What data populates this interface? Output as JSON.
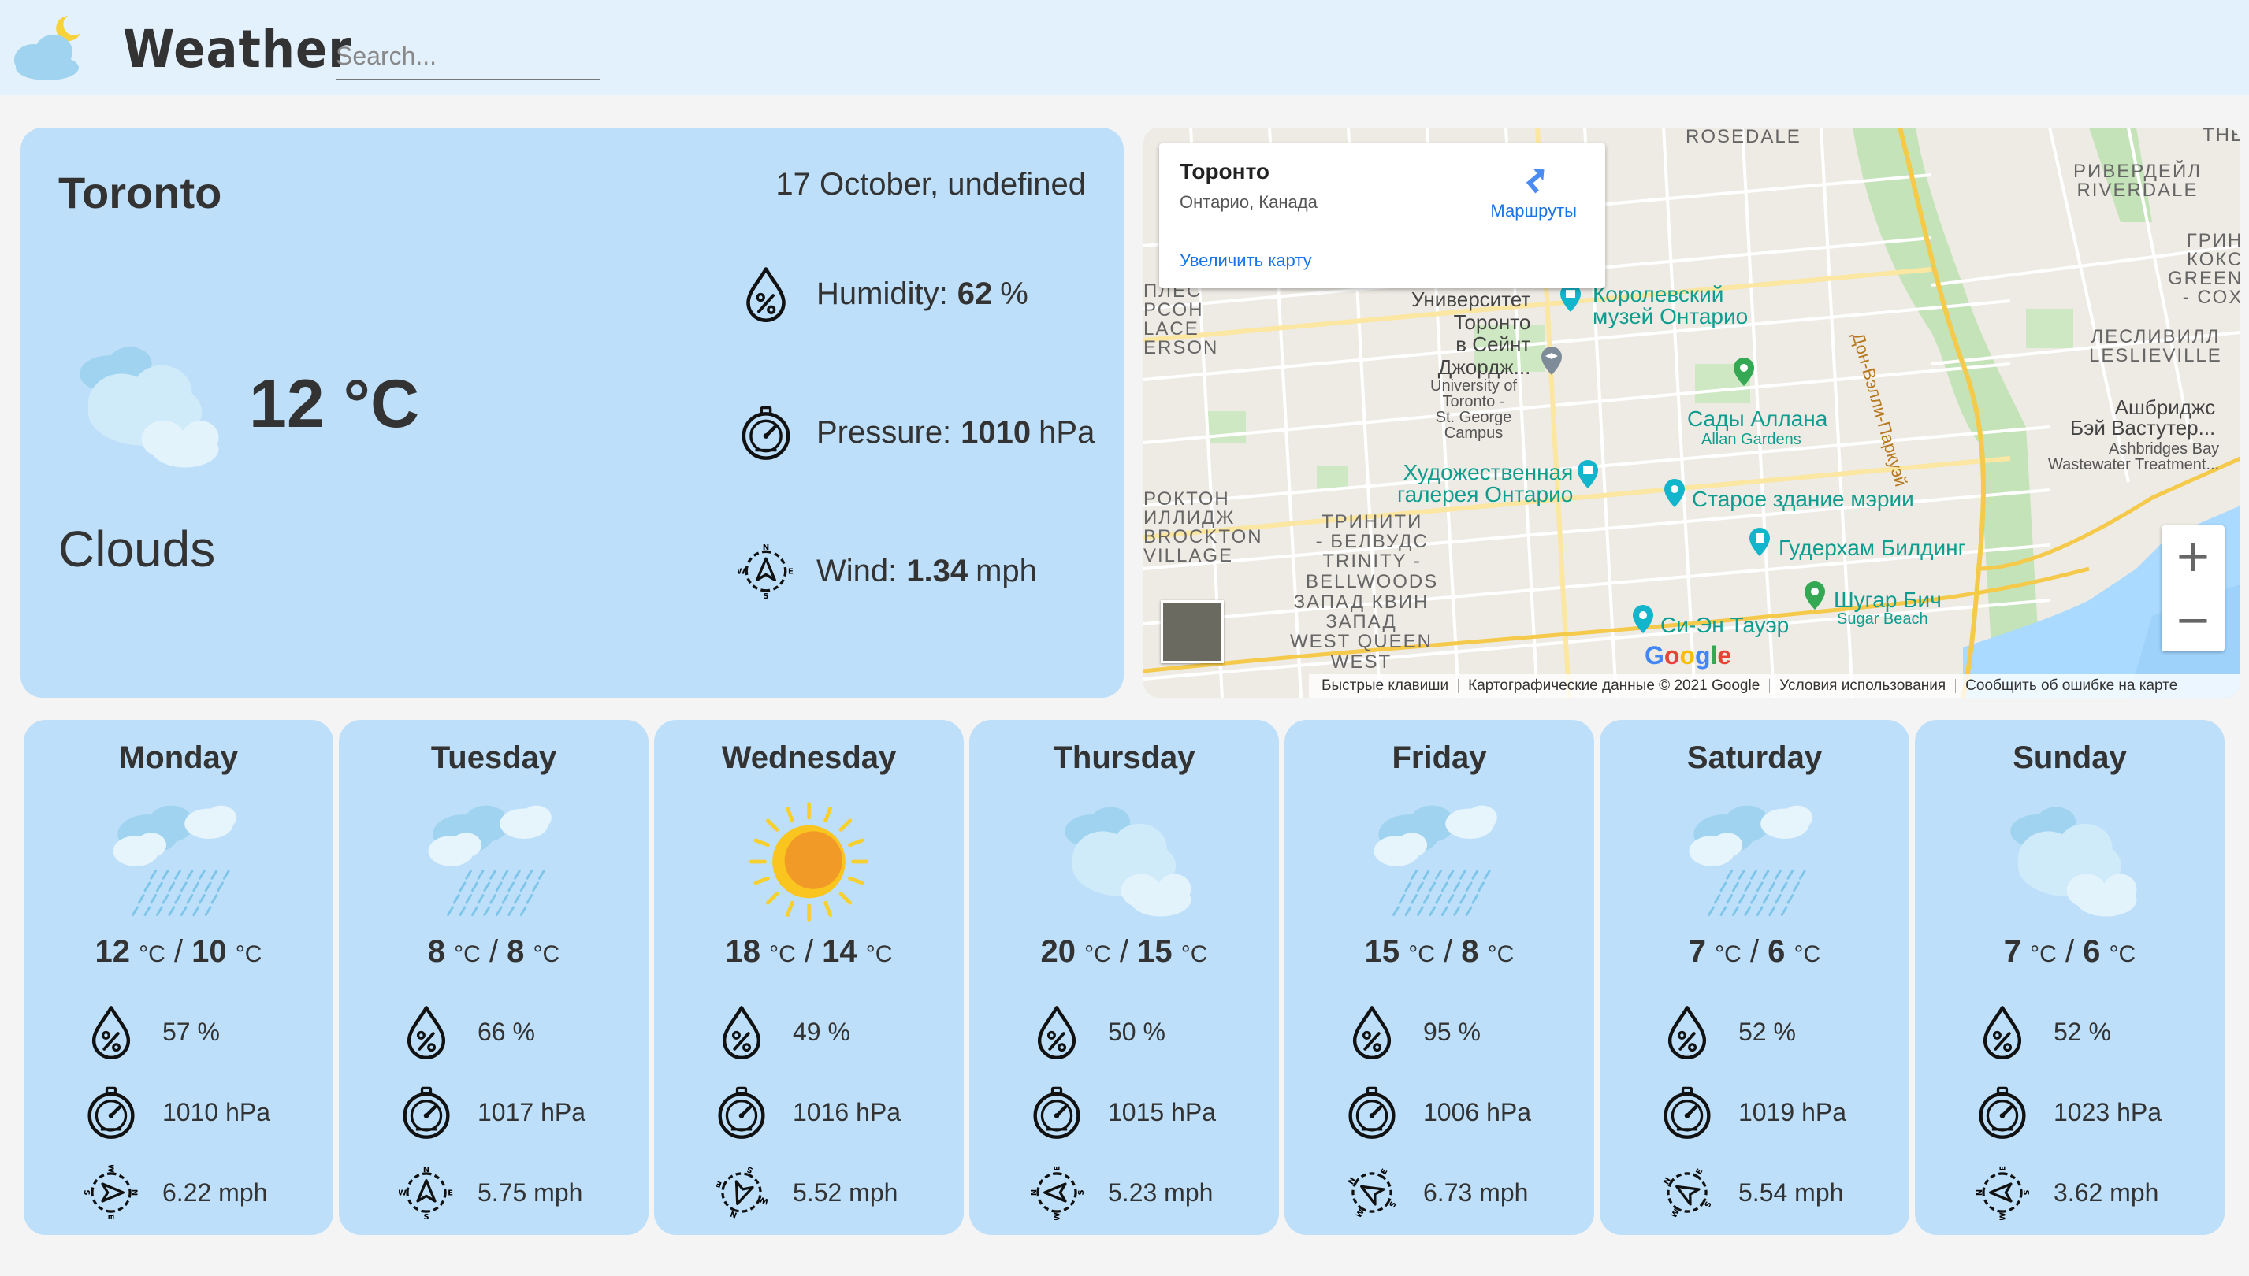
{
  "header": {
    "app_title": "Weather",
    "search_placeholder": "Search..."
  },
  "current": {
    "city": "Toronto",
    "date": "17 October, undefined",
    "temperature": "12 °C",
    "condition": "Clouds",
    "humidity_label": "Humidity:",
    "humidity_value": "62",
    "humidity_unit": "%",
    "pressure_label": "Pressure:",
    "pressure_value": "1010",
    "pressure_unit": "hPa",
    "wind_label": "Wind:",
    "wind_value": "1.34",
    "wind_unit": "mph",
    "icon": "clouds-icon"
  },
  "map": {
    "place_title": "Торонто",
    "place_subtitle": "Онтарио, Канада",
    "directions_label": "Маршруты",
    "enlarge_label": "Увеличить карту",
    "google_logo": "Google",
    "footer": [
      "Быстрые клавиши",
      "Картографические данные © 2021 Google",
      "Условия использования",
      "Сообщить об ошибке на карте"
    ],
    "labels": {
      "rosedale": "ROSEDALE",
      "riverdale": "РИВЕРДЕЙЛ\nRIVERDALE",
      "the": "THE",
      "green": "ГРИН\nКОКС\nGREEN\n- COX",
      "leslieville": "ЛЕСЛИВИЛЛ\nLESLIEVILLE",
      "ashbridges": "Ашбриджс\nБэй Вастутер...",
      "ashbridges_en": "Ashbridges Bay\nWastewater Treatment...",
      "university": "Университет\nТоронто\nв Сейнт\nДжордж...",
      "university_en": "University of\nToronto -\nSt. George\nCampus",
      "rom": "Королевский\nмузей Онтарио",
      "allan": "Сады Аллана",
      "allan_en": "Allan Gardens",
      "ago": "Художественная\nгалерея Онтарио",
      "cityhall": "Старое здание мэрии",
      "gooderham": "Гудерхам Билдинг",
      "sugar": "Шугар Бич",
      "sugar_en": "Sugar Beach",
      "cntower": "Си-Эн Тауэр",
      "trinity": "ТРИНИТИ\n- БЕЛВУДС\nTRINITY -\nBELLWOODS",
      "queen": "ЗАПАД КВИН\nЗАПАД\nWEST QUEEN\nWEST",
      "brockton": "РОКТОН\nИЛЛИДЖ\nBROCKTON\nVILLAGE",
      "dufferin": "ПЛЕС\nРСОН\nLACE\nERSON",
      "dvp": "Дон-Вэлли-Паркуэй"
    }
  },
  "forecast": [
    {
      "day": "Monday",
      "high": "12",
      "low": "10",
      "unit": "°C",
      "humidity": "57 %",
      "pressure": "1010 hPa",
      "wind": "6.22 mph",
      "icon": "rain-icon"
    },
    {
      "day": "Tuesday",
      "high": "8",
      "low": "8",
      "unit": "°C",
      "humidity": "66 %",
      "pressure": "1017 hPa",
      "wind": "5.75 mph",
      "icon": "rain-icon"
    },
    {
      "day": "Wednesday",
      "high": "18",
      "low": "14",
      "unit": "°C",
      "humidity": "49 %",
      "pressure": "1016 hPa",
      "wind": "5.52 mph",
      "icon": "sun-icon"
    },
    {
      "day": "Thursday",
      "high": "20",
      "low": "15",
      "unit": "°C",
      "humidity": "50 %",
      "pressure": "1015 hPa",
      "wind": "5.23 mph",
      "icon": "clouds-icon"
    },
    {
      "day": "Friday",
      "high": "15",
      "low": "8",
      "unit": "°C",
      "humidity": "95 %",
      "pressure": "1006 hPa",
      "wind": "6.73 mph",
      "icon": "rain-icon"
    },
    {
      "day": "Saturday",
      "high": "7",
      "low": "6",
      "unit": "°C",
      "humidity": "52 %",
      "pressure": "1019 hPa",
      "wind": "5.54 mph",
      "icon": "rain-icon"
    },
    {
      "day": "Sunday",
      "high": "7",
      "low": "6",
      "unit": "°C",
      "humidity": "52 %",
      "pressure": "1023 hPa",
      "wind": "3.62 mph",
      "icon": "clouds-icon"
    }
  ],
  "colors": {
    "header_bg": "#e3f1fc",
    "card_bg": "#bddff9",
    "page_bg": "#f4f4f4",
    "link": "#1a73e8",
    "poi": "#0f9d8f"
  }
}
